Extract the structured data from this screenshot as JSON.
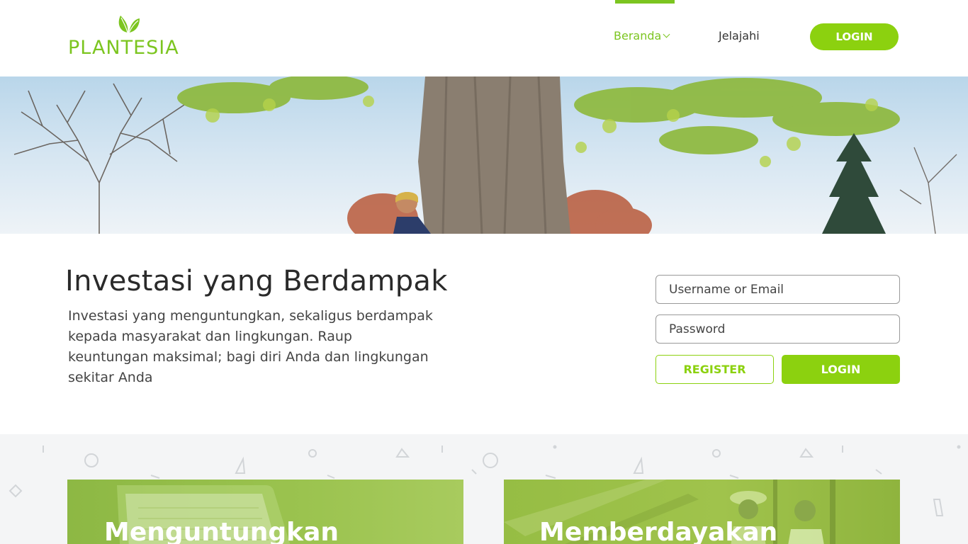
{
  "brand": {
    "name": "PLANTESIA",
    "color": "#7cc520",
    "button_color": "#8cd10f"
  },
  "nav": {
    "items": [
      {
        "label": "Beranda",
        "active": true,
        "has_dropdown": true
      },
      {
        "label": "Jelajahi",
        "active": false
      }
    ],
    "login_label": "LOGIN"
  },
  "intro": {
    "title": "Investasi yang Berdampak",
    "text": "Investasi yang menguntungkan, sekaligus berdampak kepada masyarakat dan lingkungan. Raup keuntungan maksimal; bagi diri Anda dan lingkungan sekitar Anda"
  },
  "login_form": {
    "username_placeholder": "Username or Email",
    "password_placeholder": "Password",
    "register_label": "REGISTER",
    "login_label": "LOGIN"
  },
  "features": {
    "cards": [
      {
        "title": "Menguntungkan"
      },
      {
        "title": "Memberdayakan"
      }
    ]
  }
}
